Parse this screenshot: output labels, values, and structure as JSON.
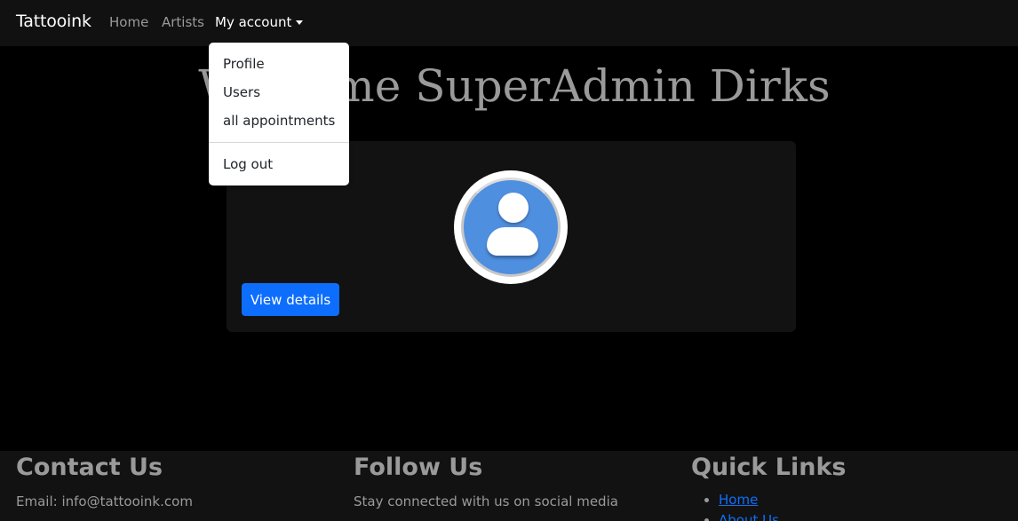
{
  "navbar": {
    "brand": "Tattooink",
    "links": {
      "home": "Home",
      "artists": "Artists",
      "account": "My account"
    }
  },
  "dropdown": {
    "profile": "Profile",
    "users": "Users",
    "appointments": "all appointments",
    "logout": "Log out"
  },
  "main": {
    "welcome": "Welcome SuperAdmin Dirks",
    "card": {
      "details_button": "View details"
    }
  },
  "footer": {
    "contact": {
      "title": "Contact Us",
      "email": "Email: info@tattooink.com"
    },
    "follow": {
      "title": "Follow Us",
      "text": "Stay connected with us on social media"
    },
    "links": {
      "title": "Quick Links",
      "items": [
        "Home",
        "About Us"
      ]
    }
  },
  "colors": {
    "primary": "#0d6efd",
    "navbar_bg": "#111111",
    "avatar": "#4f8fe0"
  },
  "icons": {
    "avatar": "user-avatar-icon",
    "caret": "caret-down-icon"
  }
}
